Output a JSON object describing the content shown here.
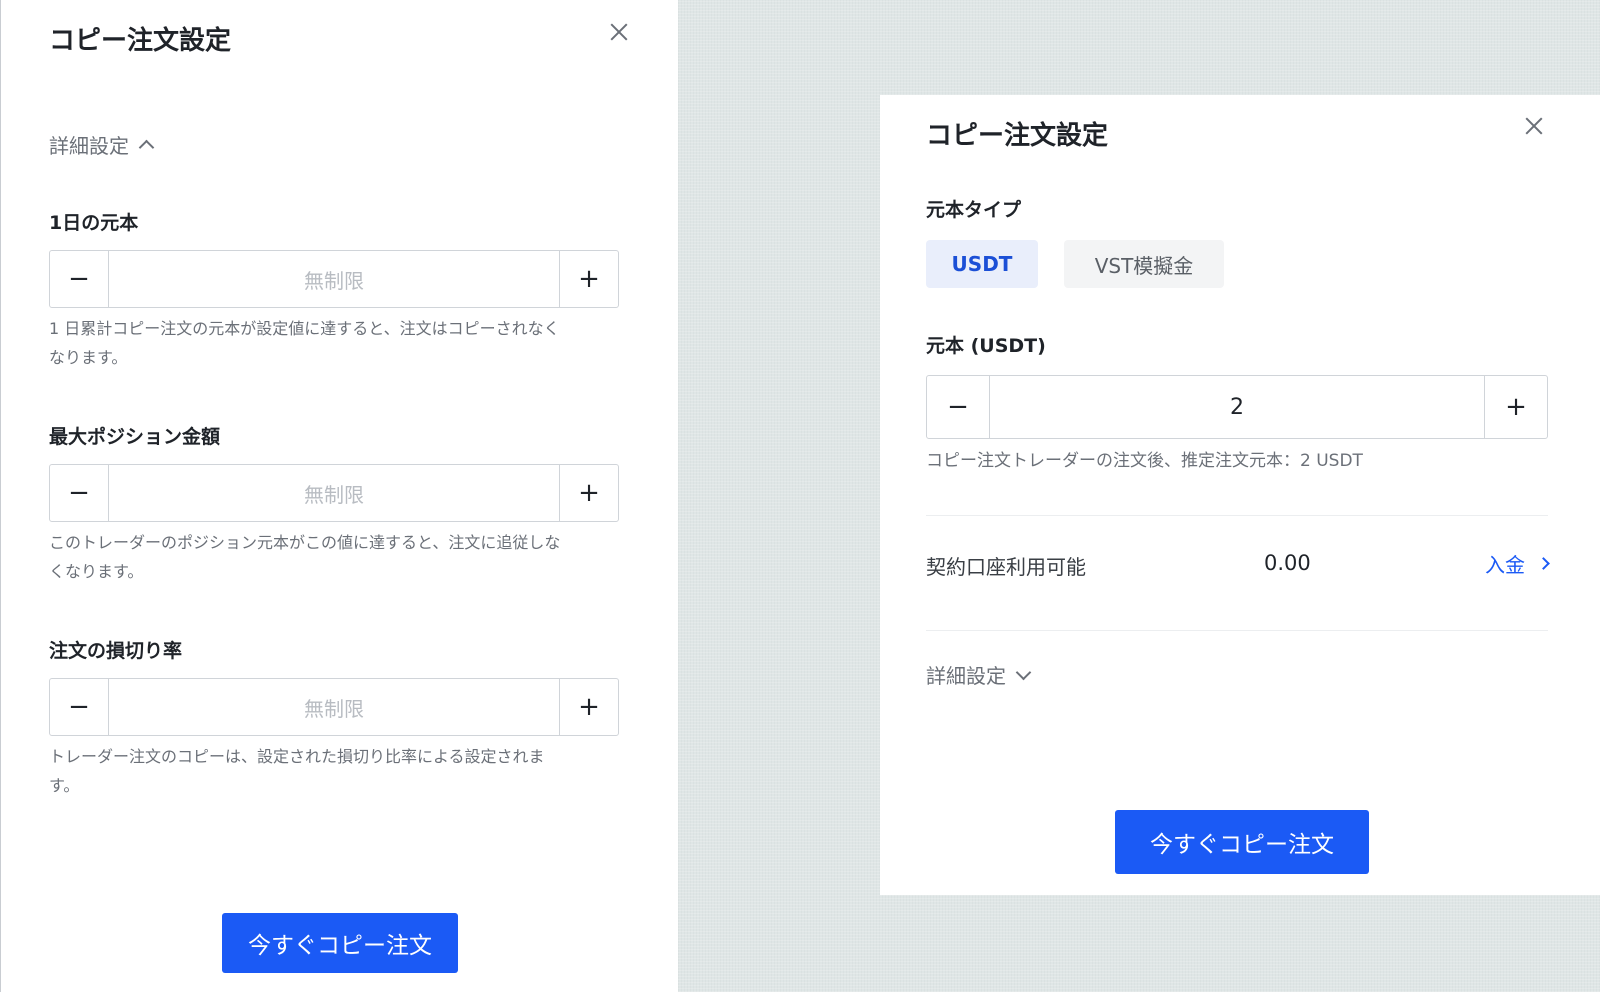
{
  "left_panel": {
    "title": "コピー注文設定",
    "advanced_label": "詳細設定",
    "fields": [
      {
        "label": "1日の元本",
        "value": "",
        "placeholder": "無制限",
        "hint_line1": "1 日累計コピー注文の元本が設定値に達すると、注文はコピーされなく",
        "hint_line2": "なります。"
      },
      {
        "label": "最大ポジション金額",
        "value": "",
        "placeholder": "無制限",
        "hint_line1": "このトレーダーのポジション元本がこの値に達すると、注文に追従しな",
        "hint_line2": "くなります。"
      },
      {
        "label": "注文の損切り率",
        "value": "",
        "placeholder": "無制限",
        "hint_line1": "トレーダー注文のコピーは、設定された損切り比率による設定されま",
        "hint_line2": "す。"
      }
    ],
    "submit_label": "今すぐコピー注文"
  },
  "right_panel": {
    "title": "コピー注文設定",
    "principal_type_label": "元本タイプ",
    "type_options": [
      "USDT",
      "VST模擬金"
    ],
    "selected_type": "USDT",
    "principal_label": "元本 (USDT)",
    "principal_value": "2",
    "principal_hint": "コピー注文トレーダーの注文後、推定注文元本：2 USDT",
    "balance_label": "契約口座利用可能",
    "balance_value": "0.00",
    "deposit_label": "入金",
    "advanced_label": "詳細設定",
    "submit_label": "今すぐコピー注文"
  },
  "icons": {
    "close": "close-icon",
    "chevron_up": "chevron-up-icon",
    "chevron_down": "chevron-down-icon",
    "chevron_right": "chevron-right-icon",
    "minus": "minus-icon",
    "plus": "plus-icon"
  },
  "colors": {
    "accent": "#1b5af5",
    "selected_tab_bg": "#e9eefb",
    "selected_tab_text": "#1b4fd6",
    "placeholder_text": "#b8bcc2"
  }
}
